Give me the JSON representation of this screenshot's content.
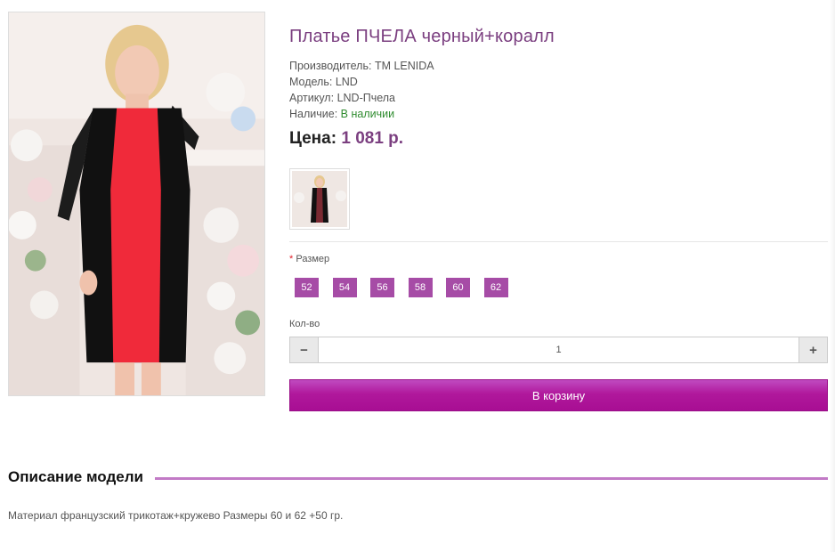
{
  "product": {
    "title": "Платье ПЧЕЛА черный+коралл",
    "manufacturer_label": "Производитель:",
    "manufacturer": "TM LENIDA",
    "model_label": "Модель:",
    "model": "LND",
    "sku_label": "Артикул:",
    "sku": "LND-Пчела",
    "availability_label": "Наличие:",
    "availability": "В наличии",
    "price_label": "Цена:",
    "price": "1 081 р."
  },
  "options": {
    "required_mark": "*",
    "size_label": "Размер",
    "sizes": [
      "52",
      "54",
      "56",
      "58",
      "60",
      "62"
    ]
  },
  "quantity": {
    "label": "Кол-во",
    "minus": "−",
    "plus": "+",
    "value": "1"
  },
  "cart": {
    "button_label": "В корзину"
  },
  "description": {
    "title": "Описание модели",
    "text": "Материал французский трикотаж+кружево Размеры 60 и 62 +50 гр."
  },
  "colors": {
    "accent": "#7b3f80",
    "size_button": "#a64ca6",
    "cart_button": "#b0189c",
    "in_stock": "#2e8b2e"
  }
}
